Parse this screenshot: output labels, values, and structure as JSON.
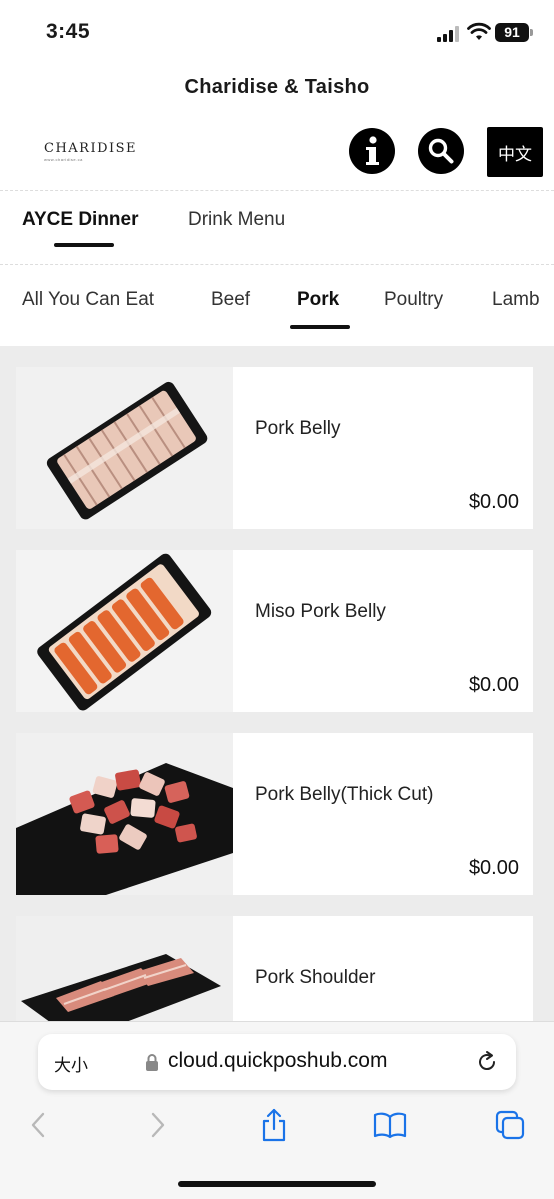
{
  "status_bar": {
    "time": "3:45",
    "battery": "91"
  },
  "header": {
    "title": "Charidise & Taisho",
    "logo_text": "CHARIDISE",
    "logo_subtext": "www.charidise.ca",
    "info_icon": "info-icon",
    "search_icon": "search-icon",
    "language_label": "中文"
  },
  "menu_tabs": [
    {
      "label": "AYCE Dinner",
      "active": true
    },
    {
      "label": "Drink Menu",
      "active": false
    }
  ],
  "category_tabs": [
    {
      "label": "All You Can Eat",
      "active": false
    },
    {
      "label": "Beef",
      "active": false
    },
    {
      "label": "Pork",
      "active": true
    },
    {
      "label": "Poultry",
      "active": false
    },
    {
      "label": "Lamb",
      "active": false
    }
  ],
  "items": [
    {
      "name": "Pork Belly",
      "price": "$0.00"
    },
    {
      "name": "Miso Pork Belly",
      "price": "$0.00"
    },
    {
      "name": "Pork Belly(Thick Cut)",
      "price": "$0.00"
    },
    {
      "name": "Pork Shoulder",
      "price": ""
    }
  ],
  "browser": {
    "text_size_label": "大小",
    "url": "cloud.quickposhub.com",
    "toolbar_icons": [
      "back-icon",
      "forward-icon",
      "share-icon",
      "bookmarks-icon",
      "tabs-icon"
    ]
  },
  "colors": {
    "accent": "#000000",
    "list_background": "#ececec",
    "safari_blue": "#1a73e8"
  }
}
